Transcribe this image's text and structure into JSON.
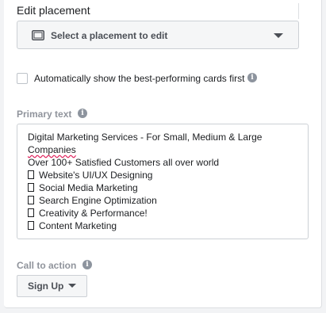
{
  "edit_placement": {
    "title": "Edit placement",
    "select_label": "Select a placement to edit",
    "icon": "desktop-icon"
  },
  "auto_show": {
    "label": "Automatically show the best-performing cards first",
    "checked": false,
    "info_glyph": "i"
  },
  "primary_text": {
    "label": "Primary text",
    "info_glyph": "i",
    "lines": [
      "Digital Marketing Services - For Small, Medium & Large",
      "Companies",
      "Over 100+ Satisfied Customers all over world",
      "Website's UI/UX Designing",
      "Social Media Marketing",
      "Search Engine Optimization",
      "Creativity & Performance!",
      "Content Marketing"
    ]
  },
  "call_to_action": {
    "label": "Call to action",
    "info_glyph": "i",
    "button_label": "Sign Up"
  },
  "colors": {
    "background": "#f2f3f5",
    "panel": "#ffffff",
    "border": "#ccd0d5",
    "muted_text": "#90949c",
    "info_icon": "#8d949e"
  }
}
